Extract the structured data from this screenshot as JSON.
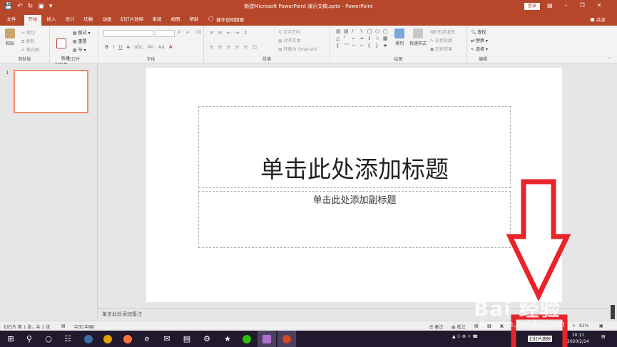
{
  "window": {
    "title": "新建Microsoft PowerPoint 演示文稿.pptx  -  PowerPoint",
    "login_label": "登录",
    "share_label": "共享",
    "tell_me": "操作说明搜索"
  },
  "tabs": [
    {
      "label": "文件",
      "active": false
    },
    {
      "label": "开始",
      "active": true
    },
    {
      "label": "插入",
      "active": false
    },
    {
      "label": "设计",
      "active": false
    },
    {
      "label": "切换",
      "active": false
    },
    {
      "label": "动画",
      "active": false
    },
    {
      "label": "幻灯片放映",
      "active": false
    },
    {
      "label": "审阅",
      "active": false
    },
    {
      "label": "视图",
      "active": false
    },
    {
      "label": "帮助",
      "active": false
    }
  ],
  "ribbon": {
    "clipboard": {
      "label": "剪贴板",
      "paste": "粘贴",
      "cut": "剪切",
      "copy": "复制",
      "format_painter": "格式刷"
    },
    "slides": {
      "label": "幻灯片",
      "new_slide": "新建\n幻灯片",
      "layout": "版式",
      "reset": "重置",
      "section": "节"
    },
    "font": {
      "label": "字体",
      "bold": "B",
      "italic": "I",
      "underline": "U",
      "strike": "S",
      "shadow": "abc",
      "spacing": "AV",
      "case": "Aa",
      "font_color": "A"
    },
    "paragraph": {
      "label": "段落",
      "text_direction": "文字方向",
      "align_text": "对齐文本",
      "smartart": "转换为 SmartArt"
    },
    "drawing": {
      "label": "绘图",
      "arrange": "排列",
      "quick_styles": "快速样式",
      "shape_fill": "形状填充",
      "shape_outline": "形状轮廓",
      "shape_effects": "形状效果"
    },
    "editing": {
      "label": "编辑",
      "find": "查找",
      "replace": "替换",
      "select": "选择"
    }
  },
  "thumbnails": [
    {
      "number": "1"
    }
  ],
  "slide": {
    "title_placeholder": "单击此处添加标题",
    "subtitle_placeholder": "单击此处添加副标题"
  },
  "notes_placeholder": "单击此处添加备注",
  "statusbar": {
    "slide_count": "幻灯片 第 1 张，共 1 张",
    "language": "中文(中国)",
    "notes": "备注",
    "comments": "批注",
    "zoom": "81%"
  },
  "taskbar": {
    "time": "10:11",
    "date": "2020/2/14",
    "notification": "幻灯片放映"
  },
  "annotation": {
    "watermark": "Bai 经验",
    "watermark_sub": "jingyan.baidu.com"
  },
  "colors": {
    "accent": "#b7472a",
    "annotation_red": "#e8232a"
  }
}
